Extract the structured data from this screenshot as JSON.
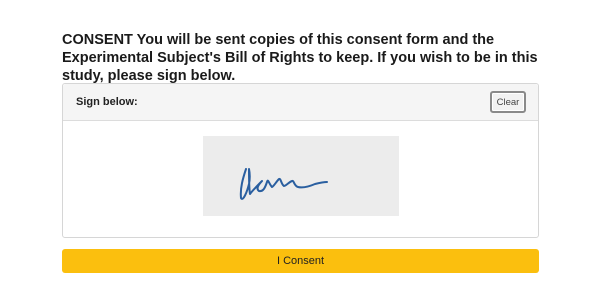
{
  "consent": {
    "text": "CONSENT You will be sent copies of this consent form and the Experimental Subject's Bill of Rights to keep. If you wish to be in this study, please sign below."
  },
  "signature_panel": {
    "label": "Sign below:",
    "clear_label": "Clear",
    "signature_ink_color": "#2a5fa0"
  },
  "actions": {
    "consent_label": "I Consent"
  },
  "colors": {
    "consent_button": "#fbbf0e",
    "pad_background": "#ececec",
    "panel_header_background": "#f5f5f5"
  }
}
